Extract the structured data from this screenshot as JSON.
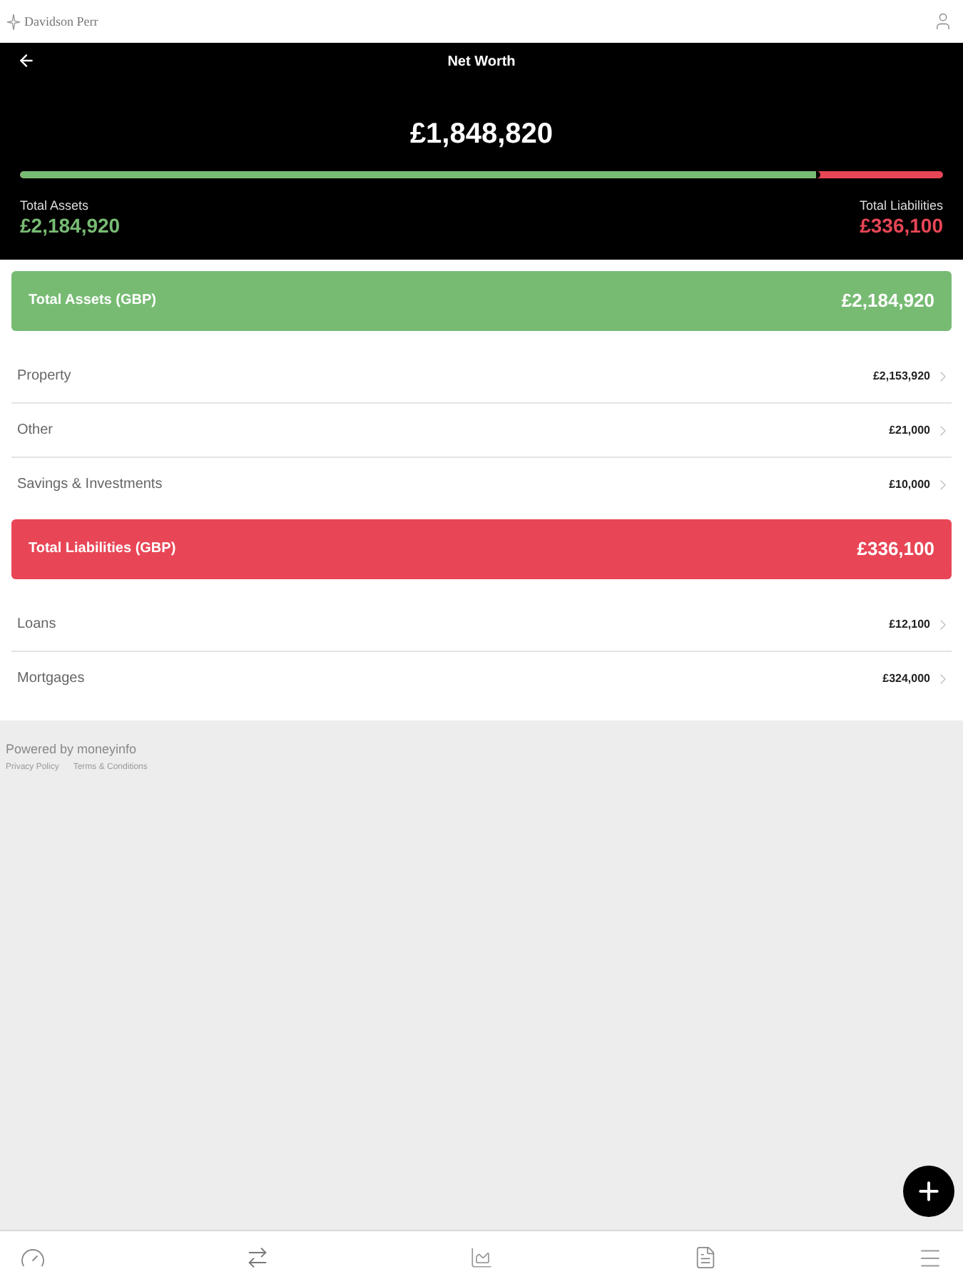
{
  "header": {
    "logo": "Davidson Perr"
  },
  "title_bar": {
    "title": "Net Worth"
  },
  "summary": {
    "net_worth": "£1,848,820",
    "bar": {
      "level": 0.867
    },
    "assets_label": "Total Assets",
    "assets_value": "£2,184,920",
    "liabilities_label": "Total Liabilities",
    "liabilities_value": "£336,100"
  },
  "sections": [
    {
      "kind": "assets",
      "title": "Total Assets (GBP)",
      "total": "£2,184,920",
      "color": "#77bb73",
      "rows": [
        {
          "name": "Property",
          "amount": "£2,153,920"
        },
        {
          "name": "Other",
          "amount": "£21,000"
        },
        {
          "name": "Savings & Investments",
          "amount": "£10,000"
        }
      ]
    },
    {
      "kind": "liabilities",
      "title": "Total Liabilities (GBP)",
      "total": "£336,100",
      "color": "#e84656",
      "rows": [
        {
          "name": "Loans",
          "amount": "£12,100"
        },
        {
          "name": "Mortgages",
          "amount": "£324,000"
        }
      ]
    }
  ],
  "footer": {
    "powered_by": "Powered by moneyinfo",
    "links": [
      "Privacy Policy",
      "Terms & Conditions"
    ]
  }
}
